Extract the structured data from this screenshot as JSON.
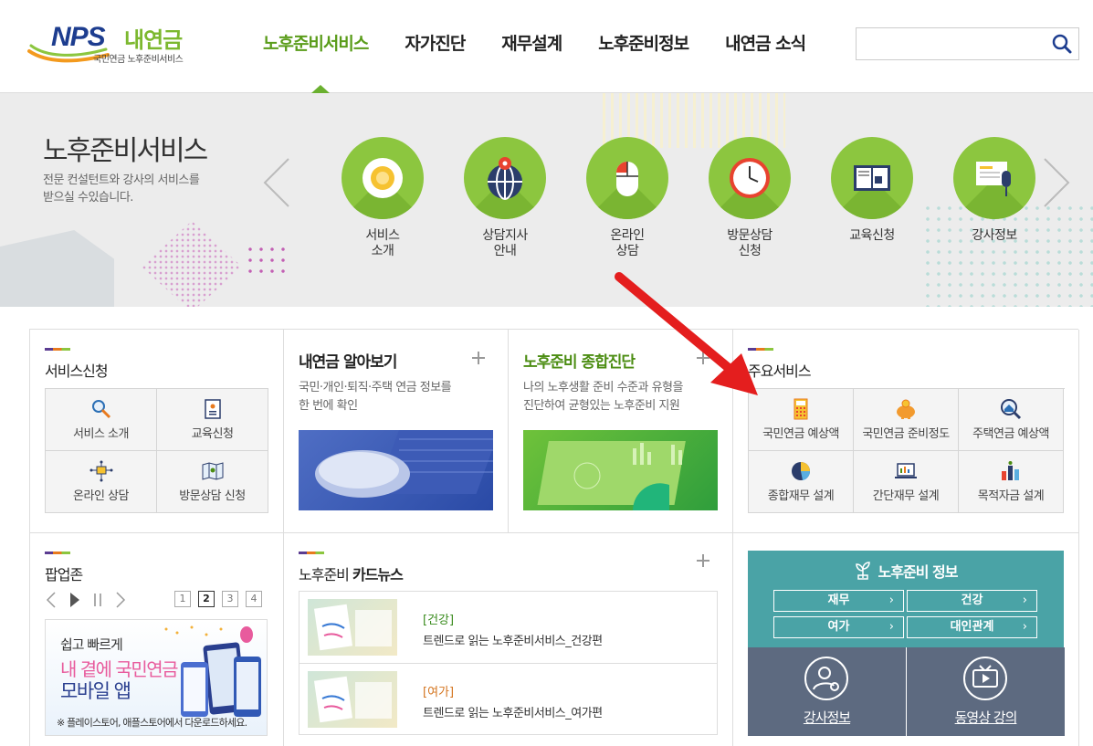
{
  "header": {
    "logo_nps": "NPS",
    "logo_name": "내연금",
    "logo_sub": "국민연금 노후준비서비스",
    "nav": [
      "노후준비서비스",
      "자가진단",
      "재무설계",
      "노후준비정보",
      "내연금 소식"
    ],
    "search_value": "",
    "accent_color": "#5a9c1a"
  },
  "hero": {
    "title": "노후준비서비스",
    "desc": "전문 컨설턴트와 강사의 서비스를\n받으실 수있습니다.",
    "services": [
      {
        "label": "서비스\n소개",
        "icon": "coffee-cup-icon"
      },
      {
        "label": "상담지사\n안내",
        "icon": "globe-pin-icon"
      },
      {
        "label": "온라인\n상담",
        "icon": "mouse-icon"
      },
      {
        "label": "방문상담\n신청",
        "icon": "clock-icon"
      },
      {
        "label": "교육신청",
        "icon": "book-icon"
      },
      {
        "label": "강사정보",
        "icon": "microphone-board-icon"
      }
    ]
  },
  "service_apply": {
    "title": "서비스신청",
    "tiles": [
      "서비스 소개",
      "교육신청",
      "온라인 상담",
      "방문상담 신청"
    ]
  },
  "my_pension": {
    "title": "내연금 알아보기",
    "desc": "국민·개인·퇴직·주택 연금 정보를\n한 번에 확인"
  },
  "diagnosis": {
    "title": "노후준비 종합진단",
    "desc": "나의 노후생활 준비 수준과 유형을\n진단하여 균형있는 노후준비 지원"
  },
  "main_services": {
    "title": "주요서비스",
    "tiles": [
      "국민연금 예상액",
      "국민연금 준비정도",
      "주택연금 예상액",
      "종합재무 설계",
      "간단재무 설계",
      "목적자금 설계"
    ]
  },
  "popup_zone": {
    "title": "팝업존",
    "pages": [
      "1",
      "2",
      "3",
      "4"
    ],
    "current_page": 2,
    "banner": {
      "line1": "쉽고 빠르게",
      "line2": "내 곁에 국민연금",
      "line3": "모바일 앱",
      "note": "※ 플레이스토어, 애플스토어에서 다운로드하세요."
    }
  },
  "card_news": {
    "title_prefix": "노후준비",
    "title_suffix": "카드뉴스",
    "items": [
      {
        "category": "[건강]",
        "title": "트렌드로 읽는 노후준비서비스_건강편",
        "color": "#3a8c1e"
      },
      {
        "category": "[여가]",
        "title": "트렌드로 읽는 노후준비서비스_여가편",
        "color": "#d4741e"
      }
    ]
  },
  "prep_info": {
    "title": "노후준비 정보",
    "buttons": [
      "재무",
      "건강",
      "여가",
      "대인관계"
    ],
    "bottom": [
      "강사정보",
      "동영상 강의"
    ]
  }
}
